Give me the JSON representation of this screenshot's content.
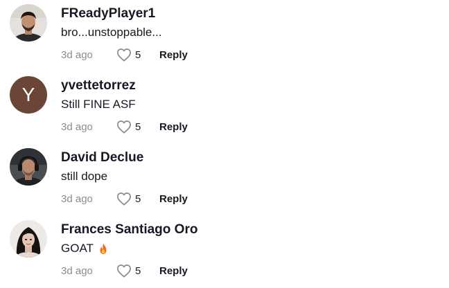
{
  "comments": [
    {
      "username": "FReadyPlayer1",
      "text": "bro...unstoppable...",
      "time": "3d ago",
      "likes": "5",
      "reply": "Reply",
      "avatar": "photo-man-dark-hair"
    },
    {
      "username": "yvettetorrez",
      "text": "Still FINE ASF",
      "time": "3d ago",
      "likes": "5",
      "reply": "Reply",
      "avatar_letter": "Y",
      "avatar_color": "#6b4535"
    },
    {
      "username": "David Declue",
      "text": "still dope",
      "time": "3d ago",
      "likes": "5",
      "reply": "Reply",
      "avatar": "photo-man-headset"
    },
    {
      "username": "Frances Santiago Oro",
      "text": "GOAT",
      "text_icon": "fire-icon",
      "time": "3d ago",
      "likes": "5",
      "reply": "Reply",
      "avatar": "photo-woman-dark-hair"
    }
  ],
  "colors": {
    "text_primary": "#161823",
    "text_secondary": "#8a8b91",
    "heart_outline": "#8a8b91"
  }
}
